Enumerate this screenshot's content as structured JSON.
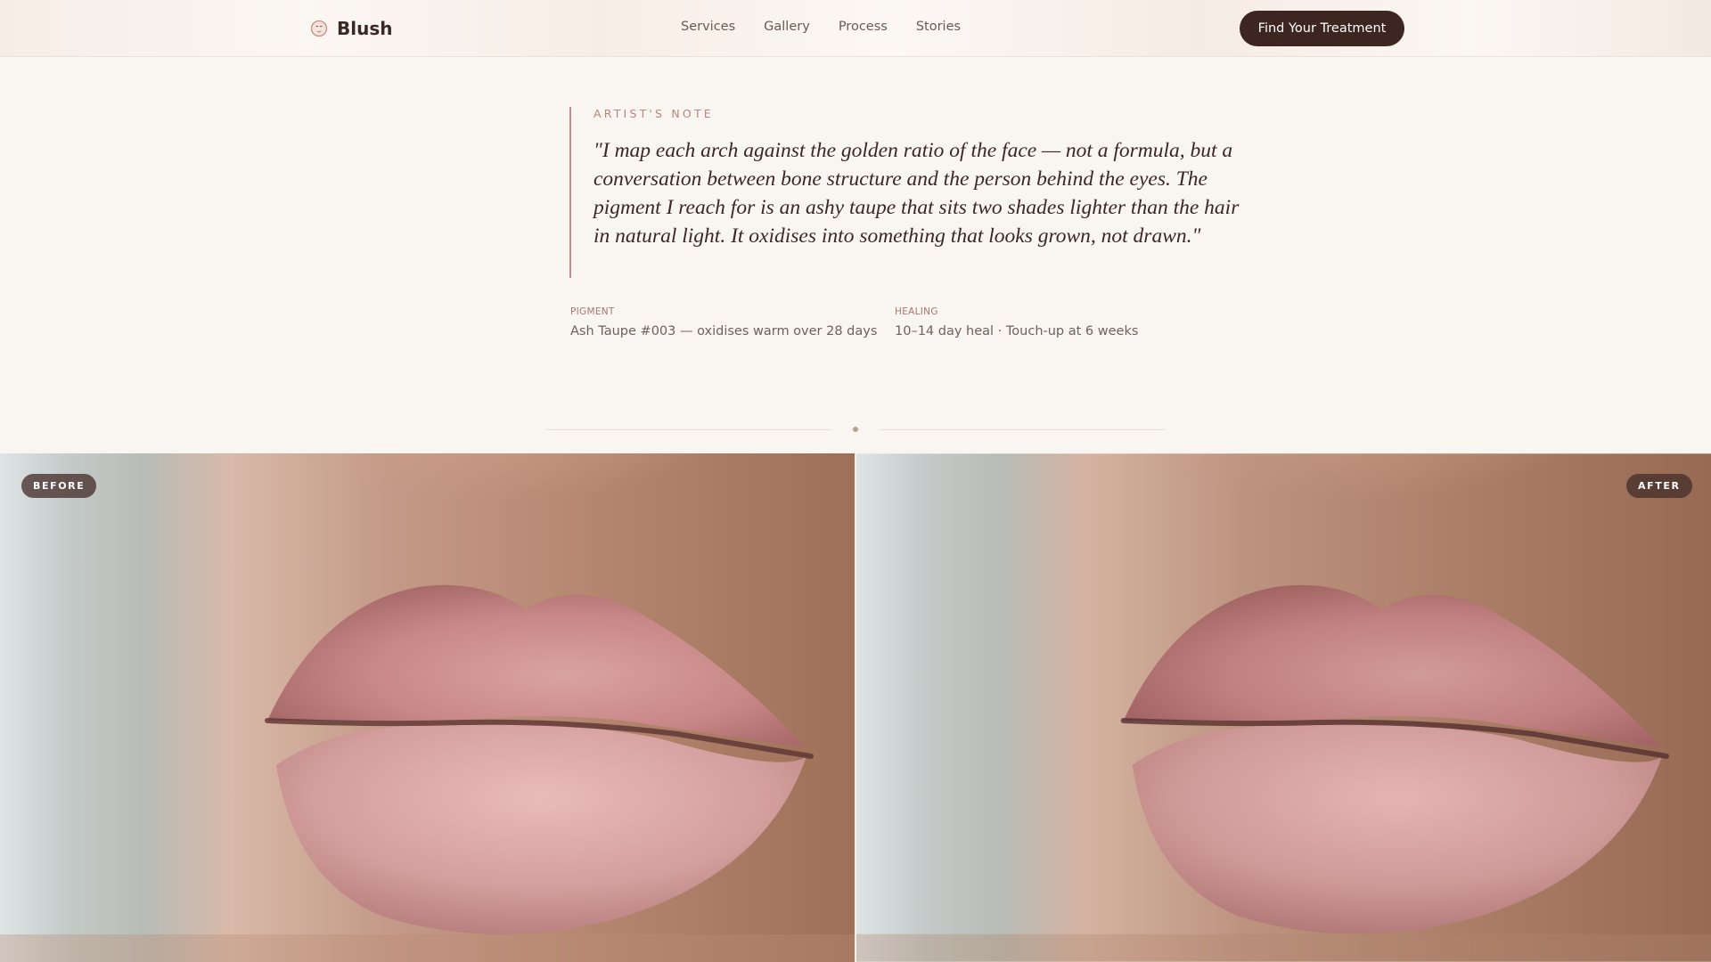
{
  "header": {
    "brand_name": "Blush",
    "brand_icon": "face-mark-icon",
    "nav": [
      {
        "label": "Services"
      },
      {
        "label": "Gallery"
      },
      {
        "label": "Process"
      },
      {
        "label": "Stories"
      }
    ],
    "cta_label": "Find Your Treatment"
  },
  "note": {
    "eyebrow": "ARTIST'S NOTE",
    "quote": "\"I map each arch against the golden ratio of the face — not a formula, but a conversation between bone structure and the person behind the eyes. The pigment I reach for is an ashy taupe that sits two shades lighter than the hair in natural light. It oxidises into something that looks grown, not drawn.\"",
    "pigment_label": "PIGMENT",
    "pigment_value": "Ash Taupe #003 — oxidises warm over 28 days",
    "healing_label": "HEALING",
    "healing_value": "10–14 day heal · Touch-up at 6 weeks"
  },
  "comparison": {
    "before_label": "BEFORE",
    "after_label": "AFTER"
  },
  "colors": {
    "accent": "#c98c86",
    "cta_bg": "#3d2521",
    "background": "#f9f6f2",
    "text": "#3b2a24"
  }
}
